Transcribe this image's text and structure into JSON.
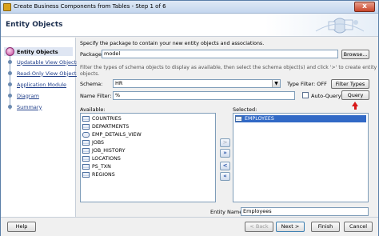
{
  "window": {
    "title": "Create Business Components from Tables - Step 1 of 6",
    "close_label": "x"
  },
  "header": {
    "title": "Entity Objects"
  },
  "nav": {
    "items": [
      {
        "label": "Entity Objects"
      },
      {
        "label": "Updatable View Objects"
      },
      {
        "label": "Read-Only View Objects"
      },
      {
        "label": "Application Module"
      },
      {
        "label": "Diagram"
      },
      {
        "label": "Summary"
      }
    ]
  },
  "main": {
    "description": "Specify the package to contain your new entity objects and associations.",
    "package_label": "Package:",
    "package_value": "model",
    "browse_label": "Browse...",
    "hint_line1": "Filter the types of schema objects to display as available, then select the schema object(s) and click '>' to create entity",
    "hint_line2": "objects.",
    "schema_label": "Schema:",
    "schema_value": "HR",
    "type_filter_label": "Type Filter: OFF",
    "filter_types_label": "Filter Types",
    "name_filter_label": "Name Filter:",
    "name_filter_value": "%",
    "auto_query_label": "Auto-Query",
    "query_label": "Query",
    "available_label": "Available:",
    "selected_label": "Selected:",
    "available_items": [
      {
        "name": "COUNTRIES",
        "icon": "table-icon"
      },
      {
        "name": "DEPARTMENTS",
        "icon": "table-icon"
      },
      {
        "name": "EMP_DETAILS_VIEW",
        "icon": "view-icon"
      },
      {
        "name": "JOBS",
        "icon": "table-icon"
      },
      {
        "name": "JOB_HISTORY",
        "icon": "table-icon"
      },
      {
        "name": "LOCATIONS",
        "icon": "table-icon"
      },
      {
        "name": "PS_TXN",
        "icon": "table-icon"
      },
      {
        "name": "REGIONS",
        "icon": "table-icon"
      }
    ],
    "selected_items": [
      {
        "name": "EMPLOYEES",
        "icon": "table-icon"
      }
    ],
    "shuttle": {
      "add": ">",
      "add_all": "»",
      "remove": "<",
      "remove_all": "«"
    },
    "entity_name_label": "Entity Name:",
    "entity_name_value": "Employees"
  },
  "footer": {
    "help_label": "Help",
    "back_label": "< Back",
    "next_label": "Next >",
    "finish_label": "Finish",
    "cancel_label": "Cancel"
  },
  "colors": {
    "accent": "#3169c6",
    "query_arrow": "#d81818",
    "nav_active": "#c0449a"
  }
}
